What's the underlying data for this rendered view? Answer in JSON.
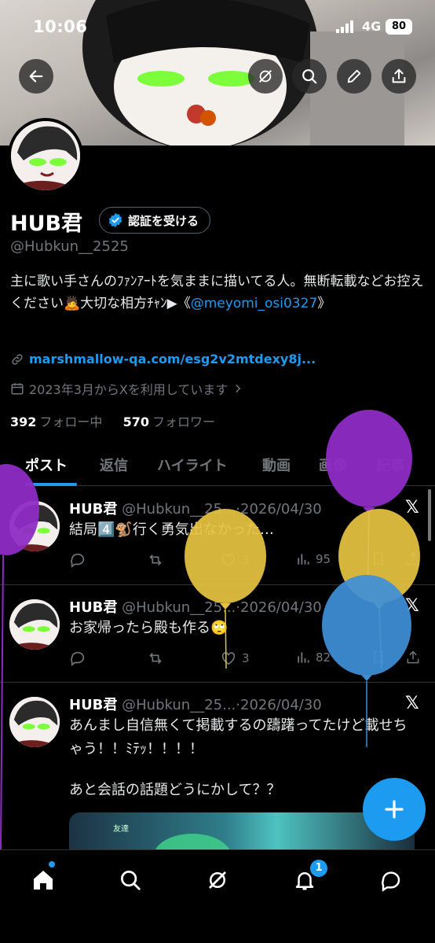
{
  "status_bar": {
    "time": "10:06",
    "network": "4G",
    "battery": "80"
  },
  "profile": {
    "name": "HUB君",
    "verify_button": "認証を受ける",
    "handle": "@Hubkun__2525",
    "bio_text": "主に歌い手さんのﾌｧﾝｱｰﾄを気ままに描いてる人。無断転載などお控えください🙇大切な相方ﾁｬﾝ▶《",
    "bio_mention": "@meyomi_osi0327",
    "bio_end": "》",
    "link": "marshmallow-qa.com/esg2v2mtdexy8j...",
    "joined": "2023年3月からXを利用しています",
    "following_count": "392",
    "following_label": "フォロー中",
    "followers_count": "570",
    "followers_label": "フォロワー"
  },
  "tabs": [
    "ポスト",
    "返信",
    "ハイライト",
    "動画",
    "画像",
    "記事"
  ],
  "posts": [
    {
      "name": "HUB君",
      "handle": "@Hubkun__25...",
      "date": "·2026/04/30",
      "text": "結局4️⃣🐒行く勇気出なかった…",
      "likes": "3",
      "views": "95"
    },
    {
      "name": "HUB君",
      "handle": "@Hubkun__25...",
      "date": "·2026/04/30",
      "text": "お家帰ったら殿も作る🙄",
      "likes": "3",
      "views": "82"
    },
    {
      "name": "HUB君",
      "handle": "@Hubkun__25...",
      "date": "·2026/04/30",
      "text": "あんまし自信無くて掲載するの躊躇ってたけど載せちゃう！！ﾐﾃｯ！！！！",
      "text2": "あと会話の話題どうにかして？？"
    }
  ],
  "image_preview_text": "友達",
  "notification_badge": "1",
  "colors": {
    "accent": "#1d9bf0",
    "background": "#000000",
    "muted": "#71767b",
    "border": "#2f3336"
  }
}
